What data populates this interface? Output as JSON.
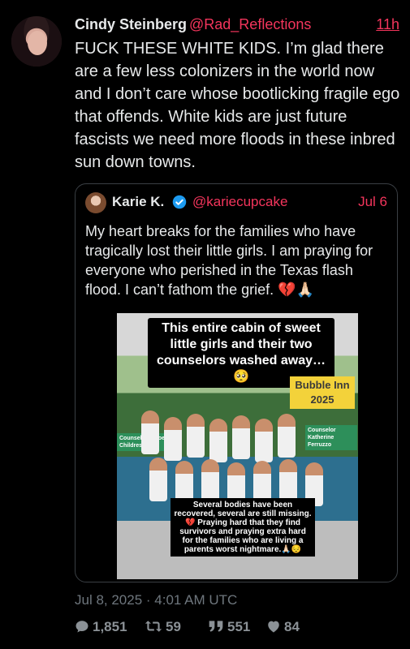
{
  "tweet": {
    "author_name": "Cindy Steinberg",
    "author_handle": "@Rad_Reflections",
    "time": "11h",
    "text": "FUCK THESE WHITE KIDS. I’m glad there are a few less colonizers in the world now and I don’t care whose bootlicking fragile ego that offends. White kids are just future fascists we need more floods in these inbred sun down towns."
  },
  "quote": {
    "author_name": "Karie K.",
    "author_handle": "@kariecupcake",
    "date": "Jul 6",
    "text": "My heart breaks for the families who have tragically lost their little girls.  I am praying for everyone who perished in the Texas flash flood.  I can’t fathom the grief. 💔🙏🏻",
    "image": {
      "caption": "This entire cabin of sweet little girls and their two counselors washed away…🥺",
      "badge": "Bubble Inn 2025",
      "label_left": "Counselor Chloe Childress",
      "label_right": "Counselor Katherine Ferruzzo",
      "bottom_text": "Several bodies have been recovered, several are still missing.💔 Praying hard that they find survivors and praying extra hard for the families who are living a parents worst nightmare.🙏🏻😔"
    }
  },
  "meta": {
    "timestamp": "Jul 8, 2025 · 4:01 AM UTC"
  },
  "stats": {
    "replies": "1,851",
    "retweets": "59",
    "quotes": "551",
    "likes": "84"
  },
  "colors": {
    "background": "#000000",
    "accent": "#f4355c",
    "text": "#e7e9ea",
    "muted": "#6e767d"
  }
}
